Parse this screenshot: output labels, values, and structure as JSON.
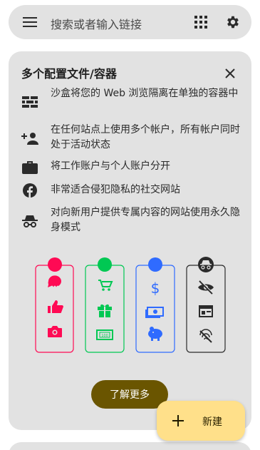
{
  "search": {
    "placeholder": "搜索或者输入链接",
    "icons": [
      "menu-icon",
      "apps-grid-icon",
      "settings-gear-icon"
    ]
  },
  "card": {
    "title": "多个配置文件/容器",
    "features": [
      {
        "icon": "brick-wall-icon",
        "text": "沙盒将您的 Web 浏览隔离在单独的容器中"
      },
      {
        "icon": "add-person-icon",
        "text": "在任何站点上使用多个帐户，所有帐户同时处于活动状态"
      },
      {
        "icon": "briefcase-icon",
        "text": "将工作账户与个人账户分开"
      },
      {
        "icon": "facebook-icon",
        "text": "非常适合侵犯隐私的社交网站"
      },
      {
        "icon": "incognito-icon",
        "text": "对向新用户提供专属内容的网站使用永久隐身模式"
      }
    ],
    "illustration": {
      "containers": [
        {
          "color": "#ff0a54",
          "icons": [
            "chat-icon",
            "thumb-up-icon",
            "camera-icon"
          ]
        },
        {
          "color": "#00c853",
          "icons": [
            "cart-icon",
            "gift-icon",
            "money-note-icon"
          ]
        },
        {
          "color": "#2f6bff",
          "icons": [
            "dollar-icon",
            "cash-icon",
            "piggy-bank-icon"
          ]
        },
        {
          "color": "#2b2b2b",
          "icons": [
            "incognito-icon",
            "eye-off-icon",
            "layout-icon",
            "fingerprint-off-icon"
          ]
        }
      ]
    },
    "learn_more_label": "了解更多"
  },
  "fab": {
    "label": "新建",
    "icon": "plus-icon"
  }
}
